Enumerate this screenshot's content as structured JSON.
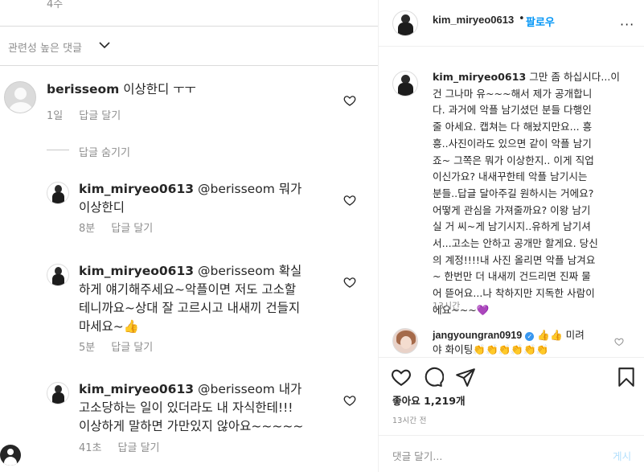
{
  "left": {
    "top_age": "4주",
    "sort_label": "관련성 높은 댓글",
    "comments": [
      {
        "username": "berisseom",
        "text": " 이상한디 ㅜㅜ",
        "age": "1일",
        "reply_label": "답글 달기"
      }
    ],
    "hide_replies_label": "답글 숨기기",
    "replies": [
      {
        "username": "kim_miryeo0613",
        "mention": " @berisseom",
        "line1": " 뭐가",
        "line2": "이상한디",
        "age": "8분",
        "reply_label": "답글 달기"
      },
      {
        "username": "kim_miryeo0613",
        "mention": " @berisseom",
        "line1": " 확실",
        "line2": "하게 얘기해주세요~악플이면 저도 고소할",
        "line3": "테니까요~상대 잘 고르시고 내새끼 건들지",
        "line4": "마세요~👍",
        "age": "5분",
        "reply_label": "답글 달기"
      },
      {
        "username": "kim_miryeo0613",
        "mention": " @berisseom",
        "line1": " 내가",
        "line2": "고소당하는 일이 있더라도 내 자식한테!!!",
        "line3": "이상하게 말하면 가만있지 않아요~~~~~",
        "age": "41초",
        "reply_label": "답글 달기"
      }
    ]
  },
  "right": {
    "header": {
      "username": "kim_miryeo0613",
      "dot": "•",
      "follow_label": "팔로우",
      "more": "···"
    },
    "caption": {
      "username": "kim_miryeo0613",
      "lines": [
        " 그만 좀 하십시다...이",
        "건 그나마 유~~~해서 제가 공개합니",
        "다. 과거에 악플 남기셨던 분들 다행인",
        "줄 아세요. 캡쳐는 다 해놨지만요... 흥",
        "흥..사진이라도 있으면 같이 악플 남기",
        "죠~ 그쪽은 뭐가 이상한지.. 이게 직업",
        "이신가요? 내새꾸한테 악플 남기시는",
        "분들..답글 달아주길 원하시는 거에요?",
        "어떻게 관심을 가져줄까요? 이왕 남기",
        "실 거 씨~게 남기시지..유하게 남기셔",
        "서...고소는 안하고 공개만 할게요. 당신",
        "의 계정!!!!내 사진 올리면 악플 남겨요",
        "~ 한번만 더 내새끼 건드리면 진짜 물",
        "어 뜯어요...나 착하지만 지독한 사람이",
        "에요~~~💜"
      ],
      "time": "13시간"
    },
    "top_comment": {
      "username": "jangyoungran0919",
      "text": " 👍👍 미려",
      "line2": "야 화이팅👏👏👏👏👏👏"
    },
    "likes": "좋아요 1,219개",
    "post_time": "13시간 전",
    "comment_placeholder": "댓글 달기...",
    "post_button": "게시"
  },
  "colors": {
    "link_blue": "#0095f6",
    "muted_gray": "#8e8e8e",
    "text_dark": "#262626",
    "post_disabled": "#b2dffc"
  }
}
